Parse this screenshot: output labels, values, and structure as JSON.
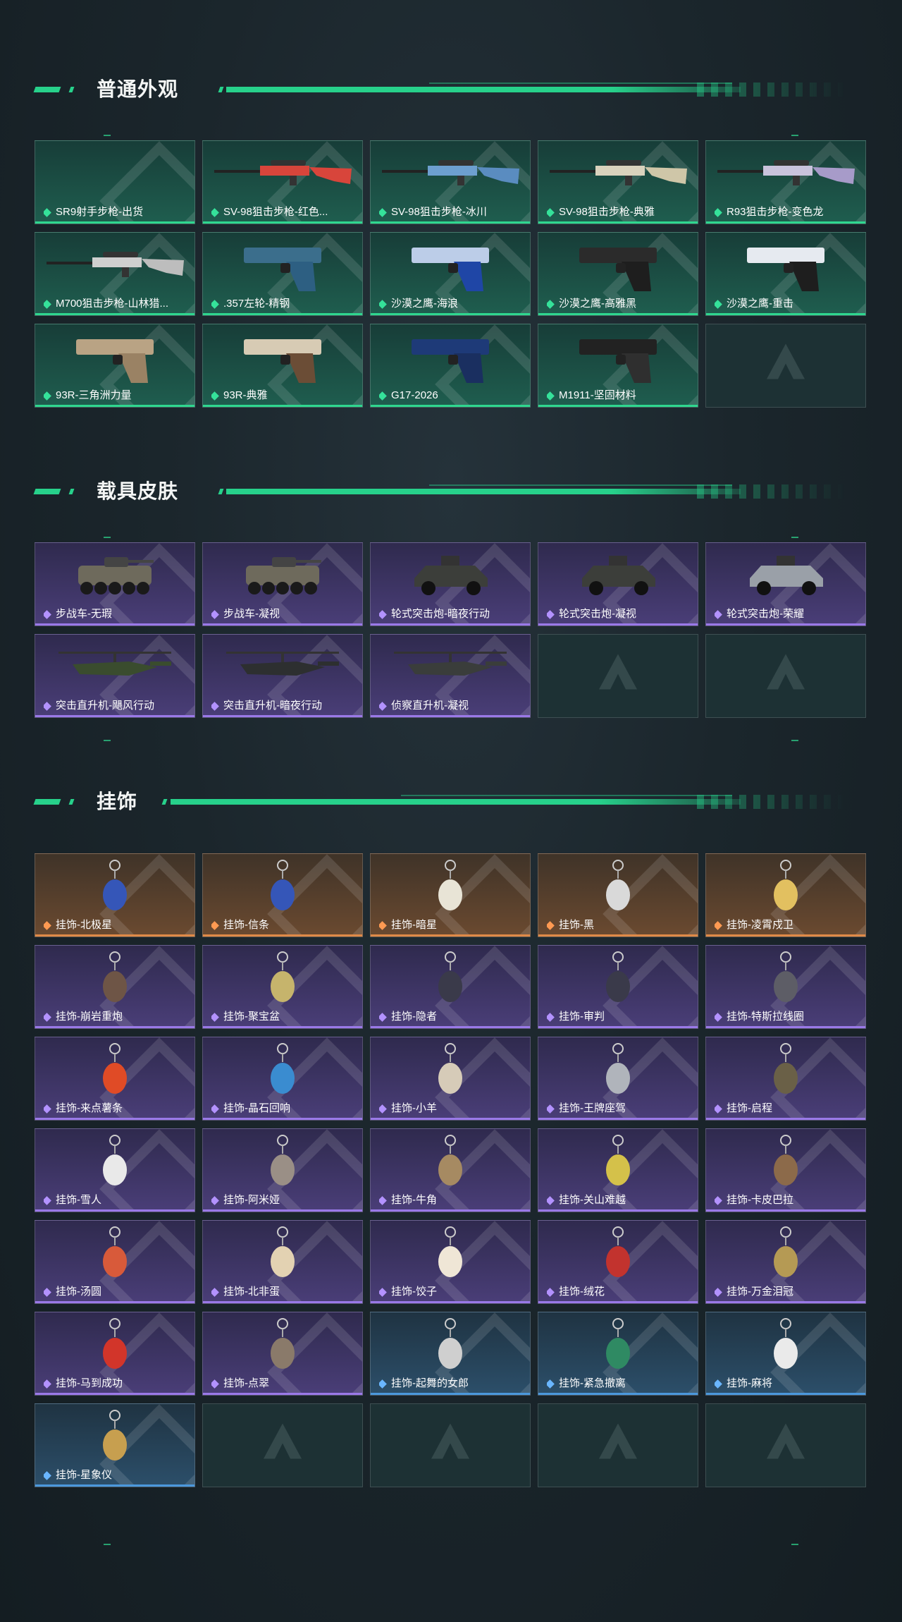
{
  "colors": {
    "accent": "#27d18b",
    "tier_green": "#2fd78f",
    "tier_purple": "#9a79e8",
    "tier_orange": "#e08a48",
    "tier_blue": "#4b98dc"
  },
  "sections": [
    {
      "title": "普通外观",
      "items": [
        {
          "label": "SR9射手步枪-出货",
          "tier": "green",
          "icon": "empty-rifle"
        },
        {
          "label": "SV-98狙击步枪-红色...",
          "tier": "green",
          "icon": "sniper-rifle-red"
        },
        {
          "label": "SV-98狙击步枪-冰川",
          "tier": "green",
          "icon": "sniper-rifle-blue"
        },
        {
          "label": "SV-98狙击步枪-典雅",
          "tier": "green",
          "icon": "sniper-rifle-cream"
        },
        {
          "label": "R93狙击步枪-变色龙",
          "tier": "green",
          "icon": "sniper-rifle-camo"
        },
        {
          "label": "M700狙击步枪-山林猎...",
          "tier": "green",
          "icon": "sniper-rifle-wood"
        },
        {
          "label": ".357左轮-精钢",
          "tier": "green",
          "icon": "revolver-icon"
        },
        {
          "label": "沙漠之鹰-海浪",
          "tier": "green",
          "icon": "pistol-blue"
        },
        {
          "label": "沙漠之鹰-高雅黑",
          "tier": "green",
          "icon": "pistol-black"
        },
        {
          "label": "沙漠之鹰-重击",
          "tier": "green",
          "icon": "pistol-white"
        },
        {
          "label": "93R-三角洲力量",
          "tier": "green",
          "icon": "pistol-tan"
        },
        {
          "label": "93R-典雅",
          "tier": "green",
          "icon": "pistol-cream"
        },
        {
          "label": "G17-2026",
          "tier": "green",
          "icon": "pistol-navy"
        },
        {
          "label": "M1911-坚固材料",
          "tier": "green",
          "icon": "pistol-dark"
        },
        {
          "label": "",
          "tier": "empty",
          "icon": "logo-watermark"
        }
      ]
    },
    {
      "title": "载具皮肤",
      "items": [
        {
          "label": "步战车-无瑕",
          "tier": "purple",
          "icon": "ifv-icon"
        },
        {
          "label": "步战车-凝视",
          "tier": "purple",
          "icon": "ifv-icon"
        },
        {
          "label": "轮式突击炮-暗夜行动",
          "tier": "purple",
          "icon": "armored-car-icon"
        },
        {
          "label": "轮式突击炮-凝视",
          "tier": "purple",
          "icon": "armored-car-icon"
        },
        {
          "label": "轮式突击炮-荣耀",
          "tier": "purple",
          "icon": "buggy-icon"
        },
        {
          "label": "突击直升机-飓风行动",
          "tier": "purple",
          "icon": "helicopter-green"
        },
        {
          "label": "突击直升机-暗夜行动",
          "tier": "purple",
          "icon": "helicopter-dark"
        },
        {
          "label": "侦察直升机-凝视",
          "tier": "purple",
          "icon": "scout-helicopter"
        },
        {
          "label": "",
          "tier": "empty",
          "icon": "logo-watermark"
        },
        {
          "label": "",
          "tier": "empty",
          "icon": "logo-watermark"
        }
      ]
    },
    {
      "title": "挂饰",
      "items": [
        {
          "label": "挂饰-北极星",
          "tier": "orange",
          "icon": "charm-figure"
        },
        {
          "label": "挂饰-信条",
          "tier": "orange",
          "icon": "charm-figure"
        },
        {
          "label": "挂饰-暗星",
          "tier": "orange",
          "icon": "charm-bird"
        },
        {
          "label": "挂饰-黑",
          "tier": "orange",
          "icon": "charm-tag"
        },
        {
          "label": "挂饰-凌霄戍卫",
          "tier": "orange",
          "icon": "charm-duck"
        },
        {
          "label": "挂饰-崩岩重炮",
          "tier": "purple",
          "icon": "charm-bear"
        },
        {
          "label": "挂饰-聚宝盆",
          "tier": "purple",
          "icon": "charm-bowl"
        },
        {
          "label": "挂饰-隐者",
          "tier": "purple",
          "icon": "charm-card"
        },
        {
          "label": "挂饰-审判",
          "tier": "purple",
          "icon": "charm-card"
        },
        {
          "label": "挂饰-特斯拉线圈",
          "tier": "purple",
          "icon": "charm-coil"
        },
        {
          "label": "挂饰-来点薯条",
          "tier": "purple",
          "icon": "charm-fries"
        },
        {
          "label": "挂饰-晶石回响",
          "tier": "purple",
          "icon": "charm-crystal"
        },
        {
          "label": "挂饰-小羊",
          "tier": "purple",
          "icon": "charm-sheep"
        },
        {
          "label": "挂饰-王牌座驾",
          "tier": "purple",
          "icon": "charm-jet"
        },
        {
          "label": "挂饰-启程",
          "tier": "purple",
          "icon": "charm-ring"
        },
        {
          "label": "挂饰-雪人",
          "tier": "purple",
          "icon": "charm-snowman"
        },
        {
          "label": "挂饰-阿米娅",
          "tier": "purple",
          "icon": "charm-bunny"
        },
        {
          "label": "挂饰-牛角",
          "tier": "purple",
          "icon": "charm-horns"
        },
        {
          "label": "挂饰-关山难越",
          "tier": "purple",
          "icon": "charm-bar"
        },
        {
          "label": "挂饰-卡皮巴拉",
          "tier": "purple",
          "icon": "charm-capybara"
        },
        {
          "label": "挂饰-汤圆",
          "tier": "purple",
          "icon": "charm-clock"
        },
        {
          "label": "挂饰-北非蛋",
          "tier": "purple",
          "icon": "charm-egg"
        },
        {
          "label": "挂饰-饺子",
          "tier": "purple",
          "icon": "charm-dumpling"
        },
        {
          "label": "挂饰-绒花",
          "tier": "purple",
          "icon": "charm-flower"
        },
        {
          "label": "挂饰-万金泪冠",
          "tier": "purple",
          "icon": "charm-crown"
        },
        {
          "label": "挂饰-马到成功",
          "tier": "purple",
          "icon": "charm-horse"
        },
        {
          "label": "挂饰-点翠",
          "tier": "purple",
          "icon": "charm-phoenix"
        },
        {
          "label": "挂饰-起舞的女郎",
          "tier": "blue",
          "icon": "charm-dancer"
        },
        {
          "label": "挂饰-紧急撤离",
          "tier": "blue",
          "icon": "charm-exit"
        },
        {
          "label": "挂饰-麻将",
          "tier": "blue",
          "icon": "charm-mahjong"
        },
        {
          "label": "挂饰-星象仪",
          "tier": "blue",
          "icon": "charm-astrolabe"
        },
        {
          "label": "",
          "tier": "empty",
          "icon": "logo-watermark"
        },
        {
          "label": "",
          "tier": "empty",
          "icon": "logo-watermark"
        },
        {
          "label": "",
          "tier": "empty",
          "icon": "logo-watermark"
        },
        {
          "label": "",
          "tier": "empty",
          "icon": "logo-watermark"
        }
      ]
    }
  ]
}
